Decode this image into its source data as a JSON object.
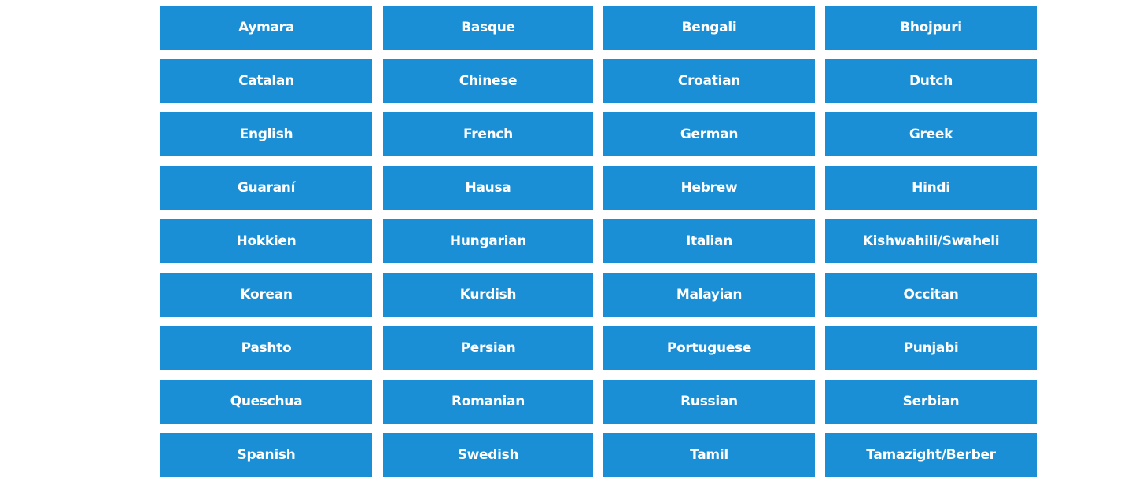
{
  "theme": {
    "button_bg": "#1b8fd5",
    "button_text": "#ffffff",
    "page_bg": "#ffffff"
  },
  "languages": [
    "Aymara",
    "Basque",
    "Bengali",
    "Bhojpuri",
    "Catalan",
    "Chinese",
    "Croatian",
    "Dutch",
    "English",
    "French",
    "German",
    "Greek",
    "Guaraní",
    "Hausa",
    "Hebrew",
    "Hindi",
    "Hokkien",
    "Hungarian",
    "Italian",
    "Kishwahili/Swaheli",
    "Korean",
    "Kurdish",
    "Malayian",
    "Occitan",
    "Pashto",
    "Persian",
    "Portuguese",
    "Punjabi",
    "Queschua",
    "Romanian",
    "Russian",
    "Serbian",
    "Spanish",
    "Swedish",
    "Tamil",
    "Tamazight/Berber"
  ]
}
